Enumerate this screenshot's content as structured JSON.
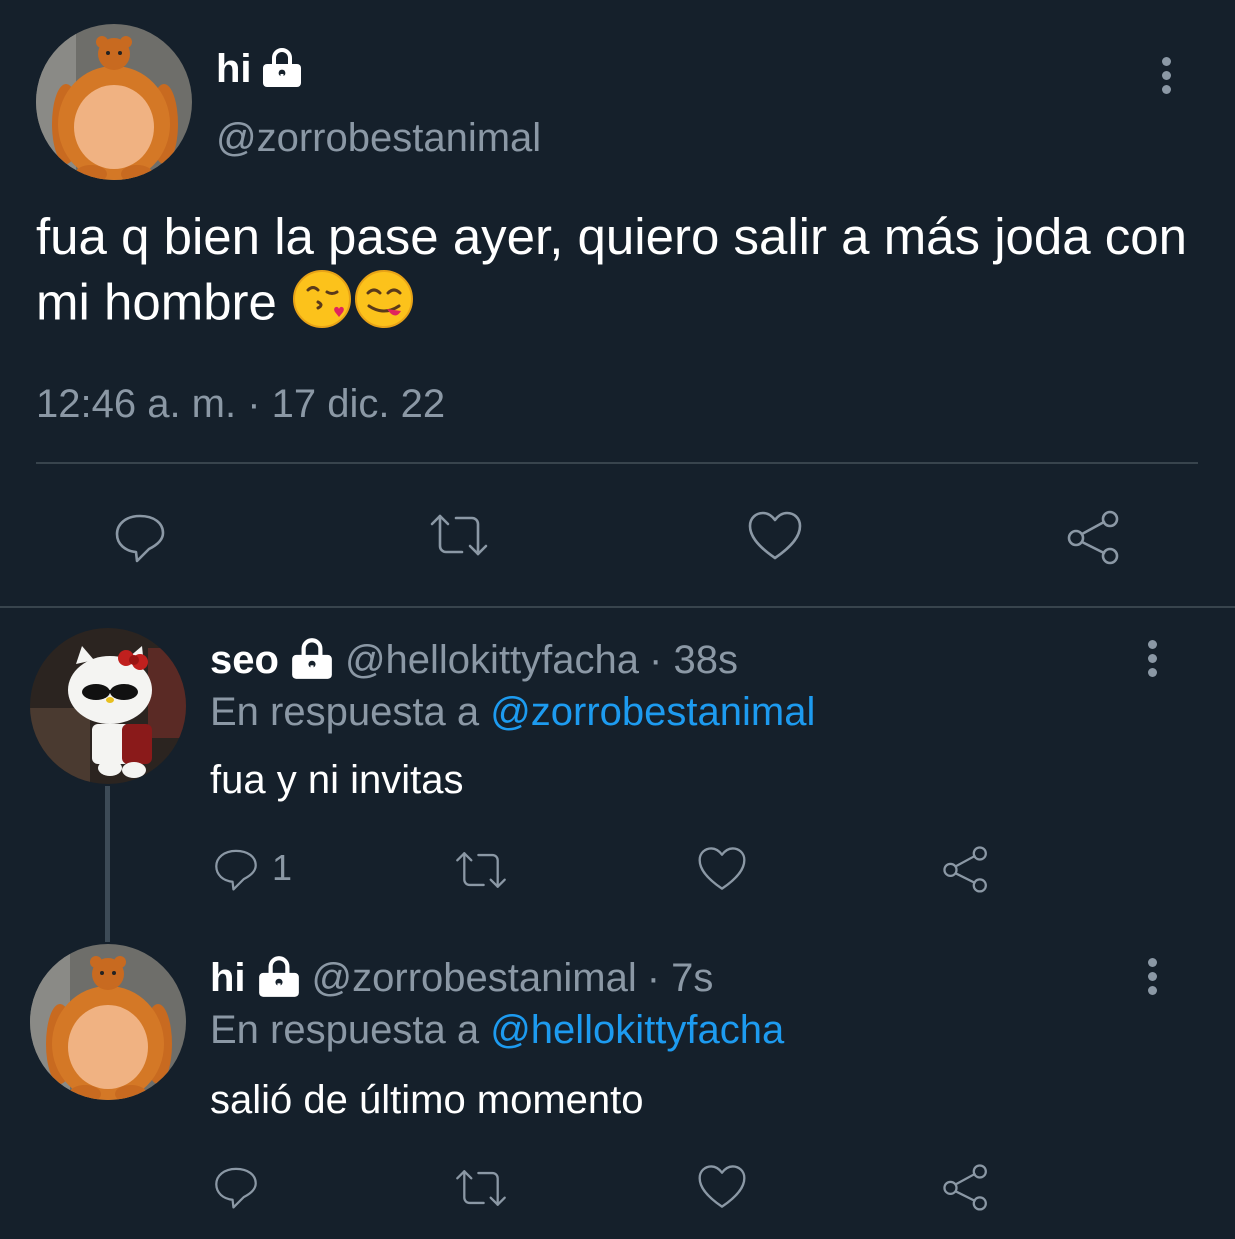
{
  "main_tweet": {
    "display_name": "hi",
    "handle": "@zorrobestanimal",
    "text": "fua q bien la pase ayer, quiero salir a más joda con mi hombre",
    "emojis": [
      "kissing-face-icon",
      "yum-face-icon"
    ],
    "timestamp": "12:46 a. m. · 17 dic. 22"
  },
  "replies": [
    {
      "display_name": "seo",
      "handle": "@hellokittyfacha",
      "time": "· 38s",
      "reply_prefix": "En respuesta a",
      "reply_to": "@zorrobestanimal",
      "text": "fua y ni invitas",
      "reply_count": "1"
    },
    {
      "display_name": "hi",
      "handle": "@zorrobestanimal",
      "time": "· 7s",
      "reply_prefix": "En respuesta a",
      "reply_to": "@hellokittyfacha",
      "text": "salió de último momento",
      "reply_count": ""
    }
  ],
  "colors": {
    "background": "#15202b",
    "muted": "#8b98a5",
    "link": "#1d9bf0",
    "divider": "#38444d"
  }
}
